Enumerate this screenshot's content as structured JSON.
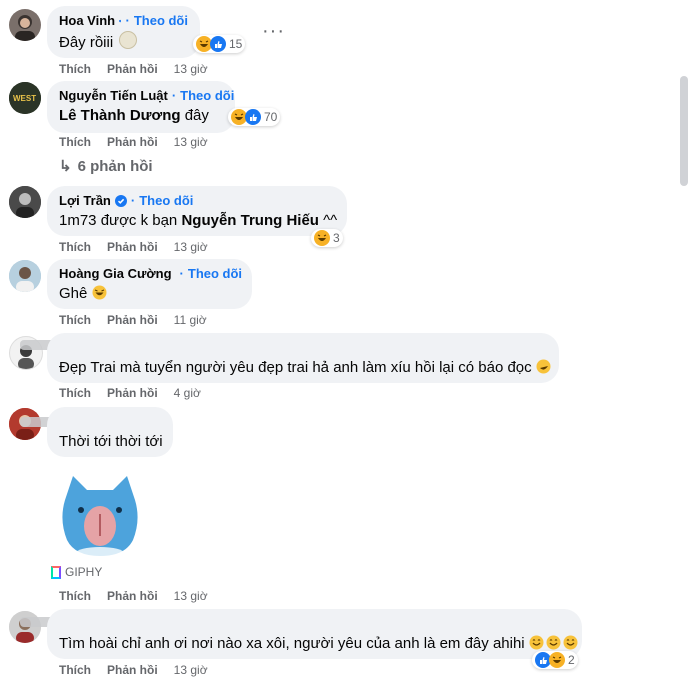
{
  "follow_label": "Theo dõi",
  "actions": {
    "like": "Thích",
    "reply": "Phản hồi"
  },
  "comments": [
    {
      "name": "Hoa Vinh",
      "verified": true,
      "text": "Đây rồiii",
      "reaction_count": "15",
      "time": "13 giờ"
    },
    {
      "name": "Nguyễn Tiến Luật",
      "verified": false,
      "text_mention": "Lê Thành Dương",
      "text_after": " đây",
      "reaction_count": "70",
      "time": "13 giờ",
      "replies": "6 phản hồi"
    },
    {
      "name": "Lợi Trần",
      "verified": true,
      "text_before": "1m73 được k bạn ",
      "text_mention": "Nguyễn Trung Hiếu",
      "text_after": " ^^",
      "reaction_count": "3",
      "time": "13 giờ"
    },
    {
      "name": "Hoàng Gia Cường",
      "verified": true,
      "text": "Ghê",
      "time": "11 giờ"
    },
    {
      "name": "",
      "text": "Đẹp Trai mà tuyển người yêu đẹp trai hả anh làm xíu hồi lại có báo đọc",
      "time": "4 giờ"
    },
    {
      "name": "",
      "text": "Thời tới thời tới",
      "gif_label": "GIPHY",
      "time": "13 giờ"
    },
    {
      "name": "",
      "text": "Tìm hoài chỉ anh ơi nơi nào xa xôi, người yêu của anh là em đây ahihi",
      "reaction_count": "2",
      "time": "13 giờ"
    }
  ],
  "colors": {
    "accent": "#1877f2",
    "bubble": "#f0f2f5",
    "meta": "#65676b"
  }
}
